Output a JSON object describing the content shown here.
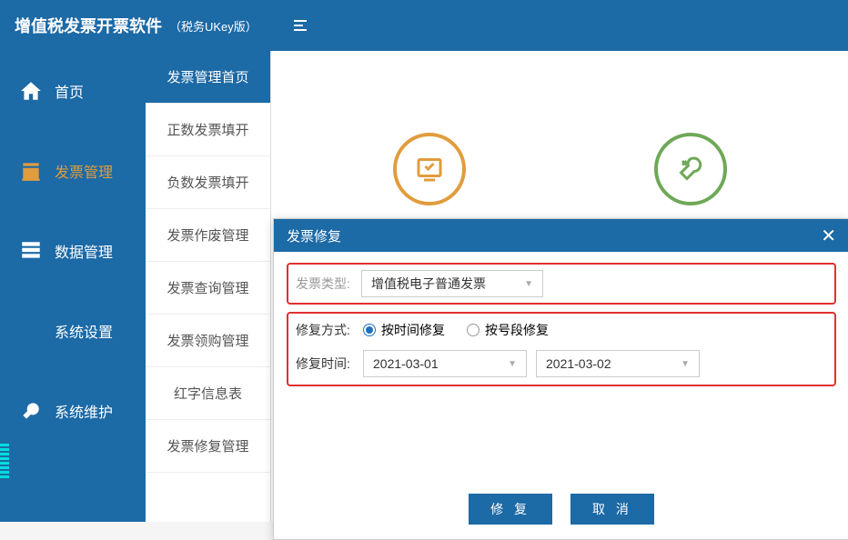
{
  "app": {
    "title": "增值税发票开票软件",
    "subtitle": "（税务UKey版）"
  },
  "sidebar": {
    "items": [
      {
        "label": "首页",
        "icon": "home-icon",
        "active": false
      },
      {
        "label": "发票管理",
        "icon": "invoice-icon",
        "active": true
      },
      {
        "label": "数据管理",
        "icon": "data-icon",
        "active": false
      },
      {
        "label": "系统设置",
        "icon": "settings-icon",
        "active": false
      },
      {
        "label": "系统维护",
        "icon": "maintenance-icon",
        "active": false
      }
    ]
  },
  "secondary_menu": {
    "items": [
      {
        "label": "发票管理首页",
        "active": true
      },
      {
        "label": "正数发票填开",
        "active": false
      },
      {
        "label": "负数发票填开",
        "active": false
      },
      {
        "label": "发票作废管理",
        "active": false
      },
      {
        "label": "发票查询管理",
        "active": false
      },
      {
        "label": "发票领购管理",
        "active": false
      },
      {
        "label": "红字信息表",
        "active": false
      },
      {
        "label": "发票修复管理",
        "active": false
      }
    ]
  },
  "modal": {
    "title": "发票修复",
    "invoice_type_label": "发票类型:",
    "invoice_type_value": "增值税电子普通发票",
    "repair_method_label": "修复方式:",
    "repair_by_time": "按时间修复",
    "repair_by_segment": "按号段修复",
    "repair_time_label": "修复时间:",
    "date_from": "2021-03-01",
    "date_to": "2021-03-02",
    "btn_repair": "修 复",
    "btn_cancel": "取 消"
  }
}
